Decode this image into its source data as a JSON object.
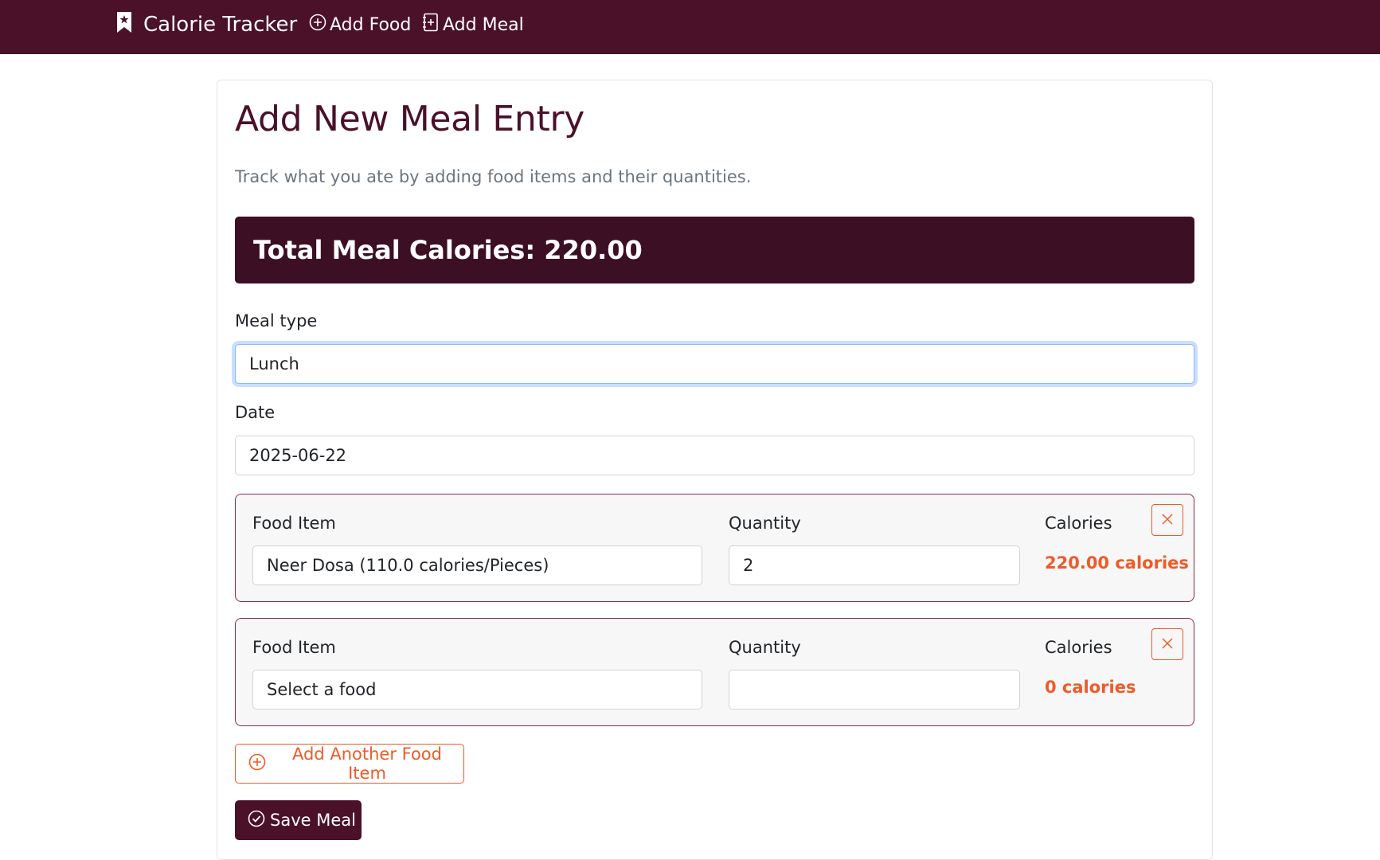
{
  "nav": {
    "brand": "Calorie Tracker",
    "links": [
      {
        "label": "Add Food"
      },
      {
        "label": "Add Meal"
      }
    ]
  },
  "page": {
    "title": "Add New Meal Entry",
    "subtitle": "Track what you ate by adding food items and their quantities."
  },
  "total": {
    "text": "Total Meal Calories: 220.00"
  },
  "form": {
    "meal_type_label": "Meal type",
    "meal_type_value": "Lunch",
    "date_label": "Date",
    "date_value": "2025-06-22"
  },
  "food_items": [
    {
      "food_label": "Food Item",
      "food_value": "Neer Dosa (110.0 calories/Pieces)",
      "quantity_label": "Quantity",
      "quantity_value": "2",
      "calories_label": "Calories",
      "calories_value": "220.00 calories"
    },
    {
      "food_label": "Food Item",
      "food_value": "Select a food",
      "quantity_label": "Quantity",
      "quantity_value": "",
      "calories_label": "Calories",
      "calories_value": "0 calories"
    }
  ],
  "buttons": {
    "add_another": "Add Another Food Item",
    "save": "Save Meal"
  },
  "colors": {
    "brand": "#4a1128",
    "accent": "#f05a28",
    "focus_border": "#86b7fe"
  }
}
